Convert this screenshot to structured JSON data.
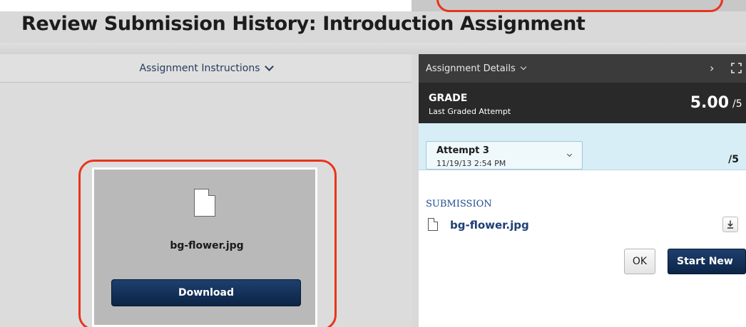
{
  "page": {
    "title": "Review Submission History: Introduction Assignment"
  },
  "instructions": {
    "label": "Assignment Instructions"
  },
  "preview": {
    "filename": "bg-flower.jpg",
    "download_label": "Download"
  },
  "details": {
    "label": "Assignment Details",
    "next_glyph": "›"
  },
  "grade": {
    "label": "GRADE",
    "sublabel": "Last Graded Attempt",
    "value": "5.00",
    "max": "/5"
  },
  "attempt": {
    "label": "Attempt 3",
    "date": "11/19/13 2:54 PM",
    "max": "/5"
  },
  "submission": {
    "label": "SUBMISSION",
    "filename": "bg-flower.jpg"
  },
  "actions": {
    "ok_label": "OK",
    "start_new_label": "Start New"
  },
  "colors": {
    "annotation": "#e8341c",
    "primary_button": "#0c2446",
    "link": "#1f3f75",
    "attempt_bg": "#d8eef6"
  }
}
